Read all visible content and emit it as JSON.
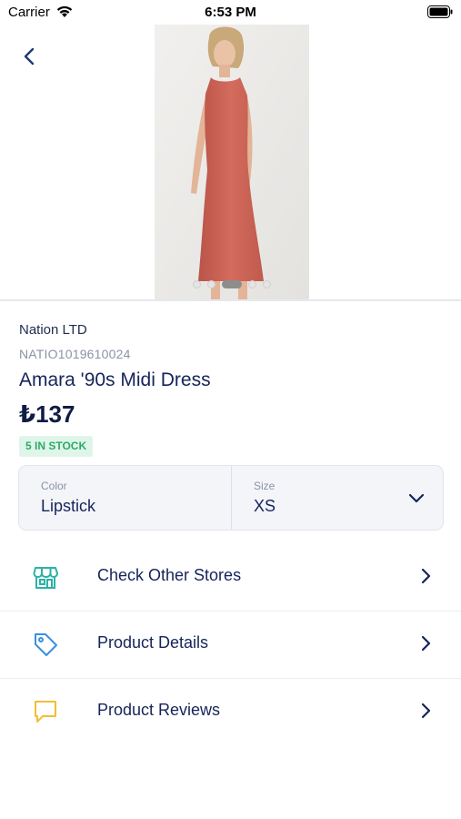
{
  "status_bar": {
    "carrier": "Carrier",
    "time": "6:53 PM"
  },
  "product": {
    "vendor": "Nation LTD",
    "sku": "NATIO1019610024",
    "name": "Amara '90s Midi Dress",
    "price": "₺137",
    "stock": "5 IN STOCK",
    "image_pages": 5,
    "active_image_page": 3
  },
  "variants": {
    "color_label": "Color",
    "color_value": "Lipstick",
    "size_label": "Size",
    "size_value": "XS"
  },
  "actions": [
    {
      "label": "Check Other Stores",
      "icon": "store-icon",
      "color": "#2ab3a6"
    },
    {
      "label": "Product Details",
      "icon": "tag-icon",
      "color": "#3a8fe0"
    },
    {
      "label": "Product Reviews",
      "icon": "chat-bubble-icon",
      "color": "#f3bd37"
    }
  ],
  "colors": {
    "primary_text": "#16245a",
    "muted_text": "#8a93a6",
    "stock_green": "#2eab67",
    "stock_bg": "#e0f5ea",
    "dress": "#d0685a"
  }
}
